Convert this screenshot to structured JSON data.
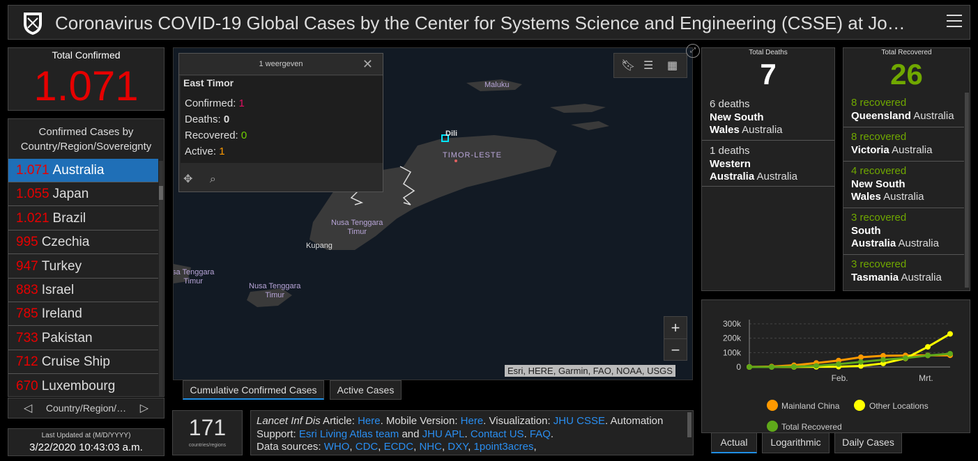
{
  "header": {
    "title": "Coronavirus COVID-19 Global Cases by the Center for Systems Science and Engineering (CSSE) at Jo…"
  },
  "total_confirmed": {
    "label": "Total Confirmed",
    "value": "1.071"
  },
  "country_list": {
    "heading_line1": "Confirmed Cases by",
    "heading_line2": "Country/Region/Sovereignty",
    "items": [
      {
        "count": "1.071",
        "name": "Australia"
      },
      {
        "count": "1.055",
        "name": "Japan"
      },
      {
        "count": "1.021",
        "name": "Brazil"
      },
      {
        "count": "995",
        "name": "Czechia"
      },
      {
        "count": "947",
        "name": "Turkey"
      },
      {
        "count": "883",
        "name": "Israel"
      },
      {
        "count": "785",
        "name": "Ireland"
      },
      {
        "count": "733",
        "name": "Pakistan"
      },
      {
        "count": "712",
        "name": "Cruise Ship"
      },
      {
        "count": "670",
        "name": "Luxembourg"
      }
    ],
    "selected_index": 0,
    "pager_label": "Country/Region/…"
  },
  "last_updated": {
    "label": "Last Updated at (M/D/YYYY)",
    "value": "3/22/2020 10:43:03 a.m."
  },
  "map": {
    "popup": {
      "header": "1 weergeven",
      "country": "East Timor",
      "confirmed_label": "Confirmed:",
      "confirmed_value": "1",
      "deaths_label": "Deaths:",
      "deaths_value": "0",
      "recovered_label": "Recovered:",
      "recovered_value": "0",
      "active_label": "Active:",
      "active_value": "1"
    },
    "labels": {
      "maluku": "Maluku",
      "dili": "Dili",
      "timor_leste": "TIMOR-LESTE",
      "ntt1_line1": "Nusa Tenggara",
      "ntt1_line2": "Timur",
      "kupang": "Kupang",
      "ntt2_line1": "sa Tenggara",
      "ntt2_line2": "Timur",
      "ntt3_line1": "Nusa Tenggara",
      "ntt3_line2": "Timur"
    },
    "zoom_in": "+",
    "zoom_out": "−",
    "attribution": "Esri, HERE, Garmin, FAO, NOAA, USGS"
  },
  "map_tabs": [
    "Cumulative Confirmed Cases",
    "Active Cases"
  ],
  "countries_count": {
    "value": "171",
    "label": "countries/regions"
  },
  "info": {
    "t1": "Lancet Inf Dis",
    "t2": " Article: ",
    "l1": "Here",
    "t3": ". Mobile Version: ",
    "l2": "Here",
    "t4": ". Visualization: ",
    "l3": "JHU CSSE",
    "t5": ". Automation Support: ",
    "l4": "Esri Living Atlas team",
    "t6": " and ",
    "l5": "JHU APL",
    "t7": ". ",
    "l6": "Contact US",
    "t8": ". ",
    "l7": "FAQ",
    "t9": ".",
    "t10": "Data sources: ",
    "l8": "WHO",
    "l9": "CDC",
    "l10": "ECDC",
    "l11": "NHC",
    "l12": "DXY",
    "l13": "1point3acres",
    "sep": ", "
  },
  "total_deaths": {
    "label": "Total Deaths",
    "value": "7",
    "items": [
      {
        "count": "6 deaths",
        "region_line1": "New South",
        "region_line2_bold": "Wales",
        "country": "Australia"
      },
      {
        "count": "1 deaths",
        "region_line1": "Western",
        "region_line2_bold": "Australia",
        "country": "Australia"
      }
    ]
  },
  "total_recovered": {
    "label": "Total Recovered",
    "value": "26",
    "items": [
      {
        "count": "8 recovered",
        "region": "Queensland",
        "country": "Australia"
      },
      {
        "count": "8 recovered",
        "region": "Victoria",
        "country": "Australia"
      },
      {
        "count": "4 recovered",
        "region_line1": "New South",
        "region": "Wales",
        "country": "Australia"
      },
      {
        "count": "3 recovered",
        "region_line1": "South",
        "region": "Australia",
        "country": "Australia"
      },
      {
        "count": "3 recovered",
        "region": "Tasmania",
        "country": "Australia"
      }
    ]
  },
  "chart_tabs": [
    "Actual",
    "Logarithmic",
    "Daily Cases"
  ],
  "colors": {
    "confirmed": "#e60000",
    "recovered": "#70a800",
    "active": "#ff9900",
    "mainland_china": "#ff9900",
    "other_locations": "#ffff00",
    "total_recovered": "#5fa81a",
    "selected_row": "#1f6fb7"
  },
  "chart_data": {
    "type": "line",
    "ylim": [
      0,
      300000
    ],
    "yticks": [
      "300k",
      "200k",
      "100k",
      "0"
    ],
    "xticks": [
      "Feb.",
      "Mrt."
    ],
    "series": [
      {
        "name": "Mainland China",
        "values": [
          600,
          3000,
          12000,
          28000,
          45000,
          68000,
          78000,
          80000,
          81000,
          81300
        ]
      },
      {
        "name": "Other Locations",
        "values": [
          0,
          100,
          400,
          1200,
          2000,
          7000,
          25000,
          60000,
          140000,
          230000
        ]
      },
      {
        "name": "Total Recovered",
        "values": [
          30,
          200,
          2000,
          8000,
          20000,
          35000,
          50000,
          62000,
          80000,
          92000
        ]
      }
    ]
  }
}
